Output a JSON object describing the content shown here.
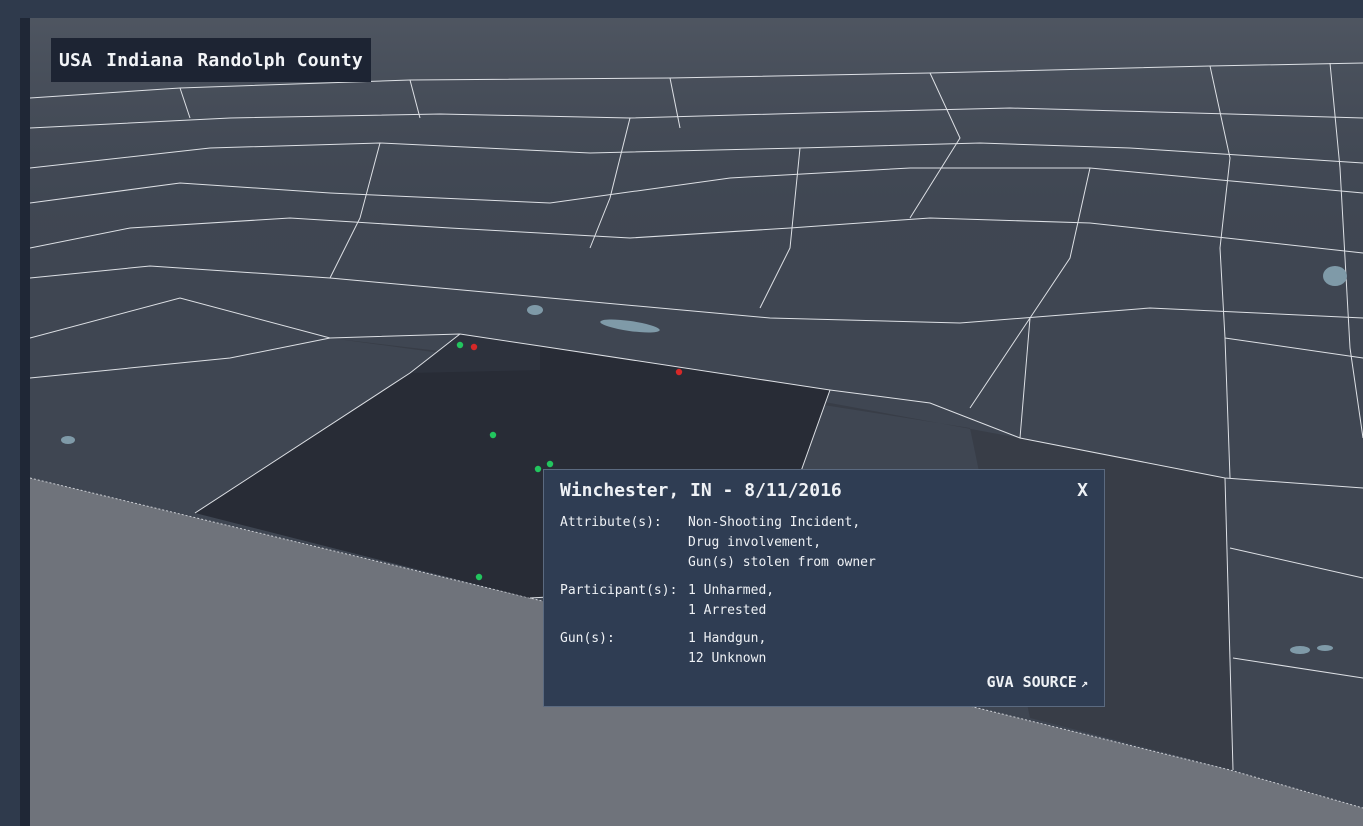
{
  "breadcrumb": [
    "USA",
    "Indiana",
    "Randolph County"
  ],
  "popup": {
    "title": "Winchester, IN - 8/11/2016",
    "close_label": "X",
    "attributes_label": "Attribute(s):",
    "attributes": [
      "Non-Shooting Incident,",
      "Drug involvement,",
      "Gun(s) stolen from owner"
    ],
    "participants_label": "Participant(s):",
    "participants": [
      "1 Unharmed,",
      "1 Arrested"
    ],
    "guns_label": "Gun(s):",
    "guns": [
      "1 Handgun,",
      "12 Unknown"
    ],
    "source_label": "GVA SOURCE",
    "source_icon": "external-arrow-icon"
  },
  "incident_marker_colors": {
    "non_fatal": "#22c55e",
    "fatal": "#d62828"
  },
  "map_colors": {
    "land": "#3f4652",
    "selected_county": "#282c36",
    "out_of_state": "#6d7078",
    "boundary": "#e6e8ec"
  }
}
